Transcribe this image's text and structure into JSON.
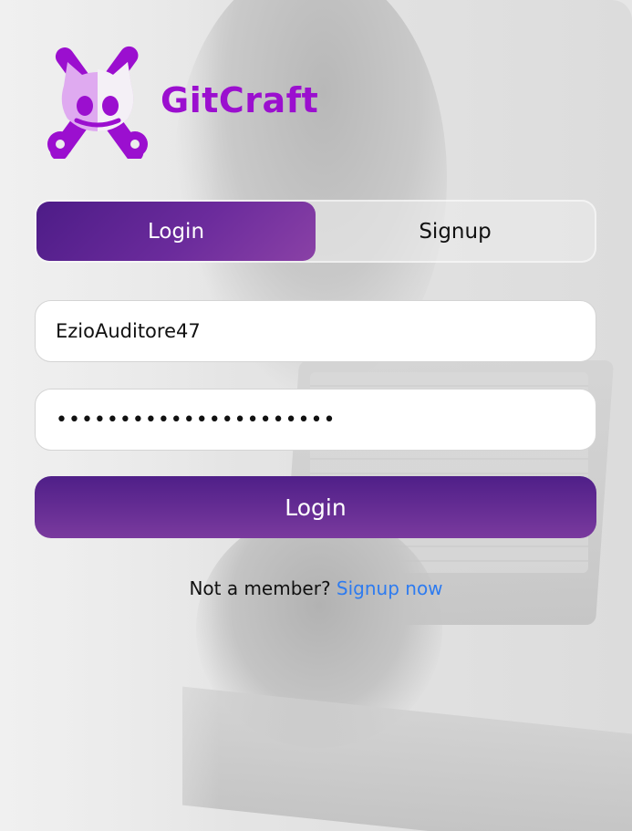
{
  "brand": {
    "name": "GitCraft",
    "color": "#9b0fcf"
  },
  "tabs": [
    {
      "label": "Login",
      "active": true
    },
    {
      "label": "Signup",
      "active": false
    }
  ],
  "form": {
    "username_value": "EzioAuditore47",
    "password_value": "••••••••••••••••••••••",
    "submit_label": "Login"
  },
  "footer": {
    "prompt": "Not a member?",
    "link_label": "Signup now"
  },
  "colors": {
    "accent_start": "#4d1c87",
    "accent_end": "#8a41a6",
    "link": "#2d7bf0"
  },
  "icons": {
    "logo": "octocat-tools-icon"
  }
}
